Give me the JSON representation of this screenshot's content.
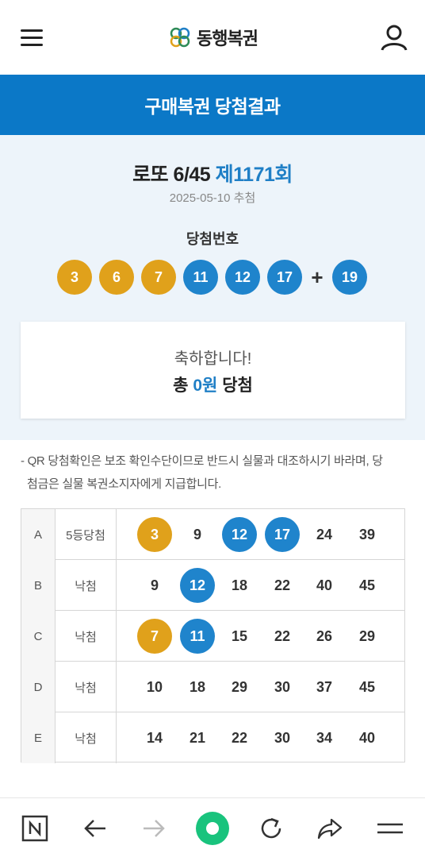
{
  "header": {
    "logo_text": "동행복권",
    "menu_icon": "hamburger-menu-icon",
    "user_icon": "user-icon",
    "logo_colors": [
      "#2e8b57",
      "#1f7fc6",
      "#e0a11b"
    ]
  },
  "banner": {
    "title": "구매복권 당첨결과",
    "bg_color": "#0b78c7"
  },
  "result": {
    "game_name": "로또 6/45",
    "round": "제1171회",
    "draw_date": "2025-05-10 추첨",
    "win_label": "당첨번호",
    "winning_numbers": [
      3,
      6,
      7,
      11,
      12,
      17
    ],
    "plus_sign": "+",
    "bonus_number": 19,
    "congrats": "축하합니다!",
    "total_prefix": "총",
    "total_amount": "0원",
    "total_suffix": "당첨"
  },
  "notice": {
    "line1": "- QR 당첨확인은 보조 확인수단이므로 반드시 실물과 대조하시기 바라며, 당",
    "line2": "첨금은 실물 복권소지자에게 지급합니다."
  },
  "ticket": {
    "rows": [
      {
        "slot": "A",
        "rank": "5등당첨",
        "numbers": [
          3,
          9,
          12,
          17,
          24,
          39
        ],
        "hits": [
          true,
          false,
          true,
          true,
          false,
          false
        ]
      },
      {
        "slot": "B",
        "rank": "낙첨",
        "numbers": [
          9,
          12,
          18,
          22,
          40,
          45
        ],
        "hits": [
          false,
          true,
          false,
          false,
          false,
          false
        ]
      },
      {
        "slot": "C",
        "rank": "낙첨",
        "numbers": [
          7,
          11,
          15,
          22,
          26,
          29
        ],
        "hits": [
          true,
          true,
          false,
          false,
          false,
          false
        ]
      },
      {
        "slot": "D",
        "rank": "낙첨",
        "numbers": [
          10,
          18,
          29,
          30,
          37,
          45
        ],
        "hits": [
          false,
          false,
          false,
          false,
          false,
          false
        ]
      },
      {
        "slot": "E",
        "rank": "낙첨",
        "numbers": [
          14,
          21,
          22,
          30,
          34,
          40
        ],
        "hits": [
          false,
          false,
          false,
          false,
          false,
          false
        ]
      }
    ]
  },
  "ball_colors": {
    "1-10": "#e0a11b",
    "11-20": "#1f84cc"
  },
  "bottom_bar": {
    "icons": [
      "naver-n-icon",
      "back-arrow-icon",
      "forward-arrow-icon",
      "home-circle-icon",
      "refresh-icon",
      "share-icon",
      "more-menu-icon"
    ],
    "home_color": "#19c37d"
  }
}
